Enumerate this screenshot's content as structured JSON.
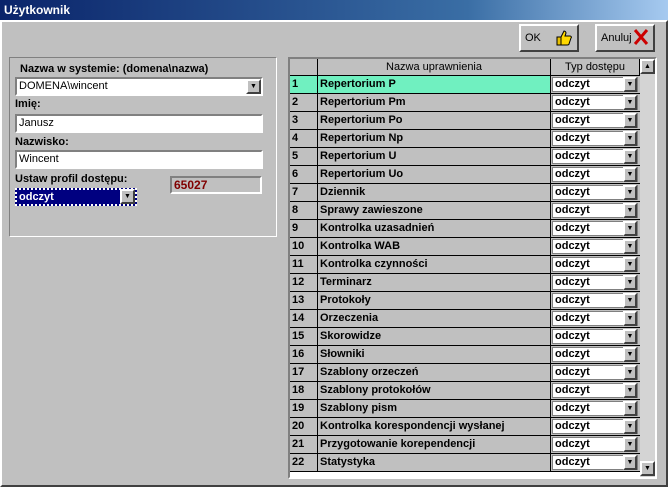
{
  "window": {
    "title": "Użytkownik"
  },
  "toolbar": {
    "ok_label": "OK",
    "cancel_label": "Anuluj"
  },
  "form": {
    "system_name_label": "Nazwa w systemie: (domena\\nazwa)",
    "system_name_value": "DOMENA\\wincent",
    "first_name_label": "Imię:",
    "first_name_value": "Janusz",
    "last_name_label": "Nazwisko:",
    "last_name_value": "Wincent",
    "profile_label": "Ustaw profil dostępu:",
    "profile_value": "odczyt",
    "profile_code": "65027"
  },
  "table": {
    "headers": [
      "",
      "Nazwa uprawnienia",
      "Typ dostępu"
    ],
    "rows": [
      {
        "num": "1",
        "name": "Repertorium P",
        "access": "odczyt"
      },
      {
        "num": "2",
        "name": "Repertorium Pm",
        "access": "odczyt"
      },
      {
        "num": "3",
        "name": "Repertorium Po",
        "access": "odczyt"
      },
      {
        "num": "4",
        "name": "Repertorium Np",
        "access": "odczyt"
      },
      {
        "num": "5",
        "name": "Repertorium U",
        "access": "odczyt"
      },
      {
        "num": "6",
        "name": "Repertorium Uo",
        "access": "odczyt"
      },
      {
        "num": "7",
        "name": "Dziennik",
        "access": "odczyt"
      },
      {
        "num": "8",
        "name": "Sprawy zawieszone",
        "access": "odczyt"
      },
      {
        "num": "9",
        "name": "Kontrolka uzasadnień",
        "access": "odczyt"
      },
      {
        "num": "10",
        "name": "Kontrolka WAB",
        "access": "odczyt"
      },
      {
        "num": "11",
        "name": "Kontrolka czynności",
        "access": "odczyt"
      },
      {
        "num": "12",
        "name": "Terminarz",
        "access": "odczyt"
      },
      {
        "num": "13",
        "name": "Protokoły",
        "access": "odczyt"
      },
      {
        "num": "14",
        "name": "Orzeczenia",
        "access": "odczyt"
      },
      {
        "num": "15",
        "name": "Skorowidze",
        "access": "odczyt"
      },
      {
        "num": "16",
        "name": "Słowniki",
        "access": "odczyt"
      },
      {
        "num": "17",
        "name": "Szablony orzeczeń",
        "access": "odczyt"
      },
      {
        "num": "18",
        "name": "Szablony protokołów",
        "access": "odczyt"
      },
      {
        "num": "19",
        "name": "Szablony pism",
        "access": "odczyt"
      },
      {
        "num": "20",
        "name": "Kontrolka korespondencji wysłanej",
        "access": "odczyt"
      },
      {
        "num": "21",
        "name": "Przygotowanie korependencji",
        "access": "odczyt"
      },
      {
        "num": "22",
        "name": "Statystyka",
        "access": "odczyt"
      }
    ]
  },
  "icons": {
    "ok": "thumbs-up-icon",
    "cancel": "red-x-icon",
    "dropdown": "chevron-down-icon"
  },
  "colors": {
    "titlebar": "#0a246a",
    "active_row": "#70f0c0",
    "profile_code": "#800000",
    "cancel_icon": "#cc0000"
  }
}
